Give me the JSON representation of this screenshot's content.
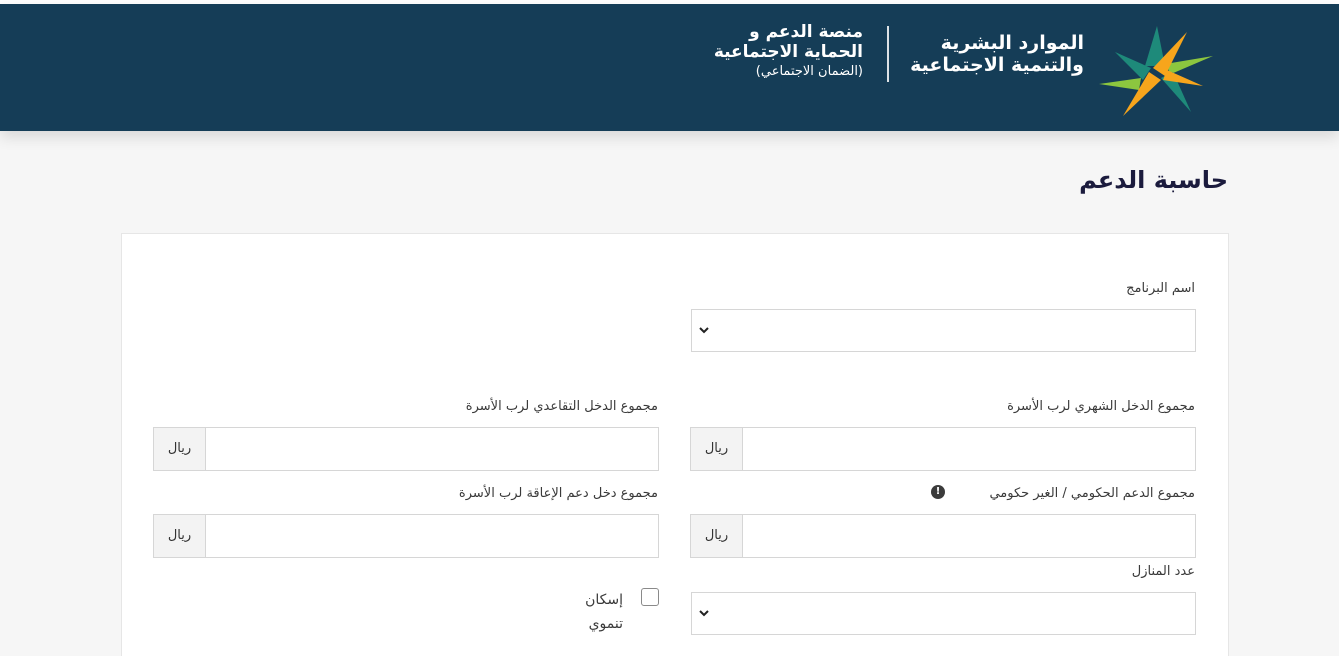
{
  "header": {
    "ministry_line1": "الموارد البشرية",
    "ministry_line2": "والتنمية الاجتماعية",
    "platform_line1": "منصة الدعم و",
    "platform_line2": "الحماية الاجتماعية",
    "platform_line3": "(الضمان الاجتماعي)",
    "logo_icon": "ministry-logo-icon",
    "bg_color": "#153d57"
  },
  "page": {
    "title": "حاسبة الدعم"
  },
  "form": {
    "program": {
      "label": "اسم البرنامج",
      "value": ""
    },
    "monthly_income": {
      "label": "مجموع الدخل الشهري لرب الأسرة",
      "addon": "ريال",
      "value": ""
    },
    "retirement_income": {
      "label": "مجموع الدخل التقاعدي لرب الأسرة",
      "addon": "ريال",
      "value": ""
    },
    "gov_support": {
      "label": "مجموع الدعم الحكومي / الغير حكومي",
      "addon": "ريال",
      "value": "",
      "info_icon": "info-icon",
      "info_glyph": "!"
    },
    "disability_income": {
      "label": "مجموع دخل دعم الإعاقة لرب الأسرة",
      "addon": "ريال",
      "value": ""
    },
    "houses_count": {
      "label": "عدد المنازل",
      "value": ""
    },
    "developmental_housing": {
      "label_line1": "إسكان",
      "label_line2": "تنموي",
      "checked": false
    }
  }
}
